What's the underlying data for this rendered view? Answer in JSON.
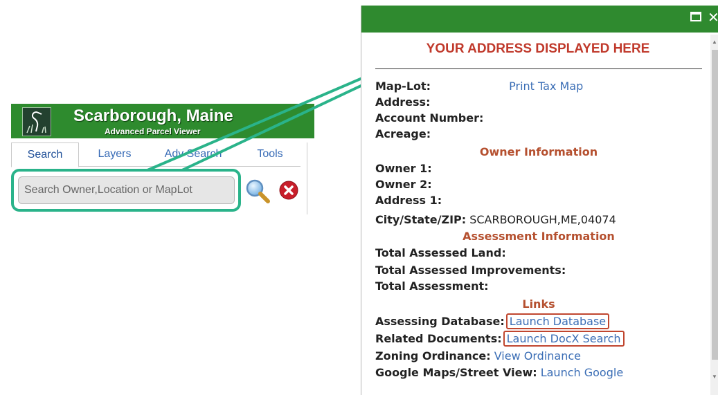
{
  "viewer": {
    "title": "Scarborough, Maine",
    "subtitle": "Advanced Parcel Viewer",
    "tabs": [
      {
        "label": "Search"
      },
      {
        "label": "Layers"
      },
      {
        "label": "Adv Search"
      },
      {
        "label": "Tools"
      }
    ],
    "active_tab": "Search",
    "search": {
      "placeholder": "Search Owner,Location or MapLot",
      "value": ""
    },
    "icons": [
      "heron-logo-icon",
      "magnifier-search-icon",
      "clear-x-icon"
    ]
  },
  "popup": {
    "address_title": "YOUR ADDRESS DISPLAYED HERE",
    "rows": {
      "map_lot": {
        "label": "Map-Lot:",
        "link": "Print Tax Map"
      },
      "address": {
        "label": "Address:"
      },
      "account_number": {
        "label": "Account Number:"
      },
      "acreage": {
        "label": "Acreage:"
      }
    },
    "owner_section": "Owner Information",
    "owner_rows": {
      "owner1": {
        "label": "Owner 1:"
      },
      "owner2": {
        "label": "Owner 2:"
      },
      "address1": {
        "label": "Address 1:"
      },
      "city_state_zip": {
        "label": "City/State/ZIP:",
        "value": " SCARBOROUGH,ME,04074"
      }
    },
    "assessment_section": "Assessment Information",
    "assessment_rows": {
      "land": {
        "label": "Total Assessed Land:"
      },
      "improvements": {
        "label": "Total Assessed Improvements:"
      },
      "total": {
        "label": "Total Assessment:"
      }
    },
    "links_section": "Links",
    "links": {
      "assessing": {
        "label": "Assessing Database:",
        "link": "Launch Database"
      },
      "documents": {
        "label": "Related Documents:",
        "link": "Launch DocX Search"
      },
      "zoning": {
        "label": "Zoning Ordinance:",
        "link": " View Ordinance"
      },
      "maps": {
        "label": "Google Maps/Street View:",
        "link": " Launch Google"
      }
    },
    "header_icons": [
      "maximize-icon",
      "close-icon"
    ],
    "close_glyph": "✕"
  },
  "colors": {
    "header_green": "#2e8b2e",
    "highlight_teal": "#2ab38a",
    "section_red": "#b5502f",
    "link_blue": "#3a6db5"
  }
}
